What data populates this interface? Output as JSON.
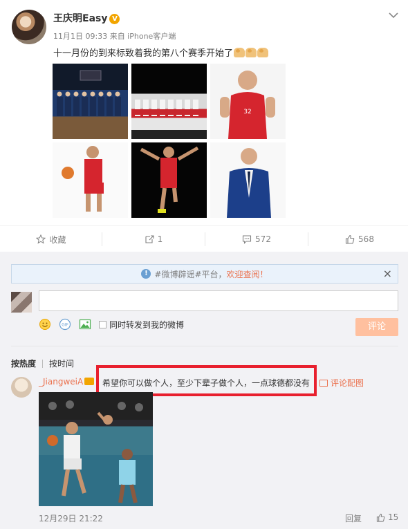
{
  "post": {
    "username": "王庆明Easy",
    "verified_badge": "V",
    "meta": "11月1日 09:33 来自 iPhone客户端",
    "text": "十一月份的到来标致着我的第八个赛季开始了",
    "photos": [
      {
        "name": "team-photo-suits"
      },
      {
        "name": "team-photo-uniforms"
      },
      {
        "name": "player-portrait-jersey"
      },
      {
        "name": "player-dribbling"
      },
      {
        "name": "player-jumping"
      },
      {
        "name": "player-portrait-suit"
      }
    ]
  },
  "actions": {
    "favorite": "收藏",
    "forward_count": "1",
    "comment_count": "572",
    "like_count": "568"
  },
  "notice": {
    "prefix": "#微博辟谣#平台，",
    "link": "欢迎查阅！",
    "close": "×"
  },
  "composer": {
    "forward_label": "同时转发到我的微博",
    "submit_label": "评论"
  },
  "sort": {
    "by_hot": "按热度",
    "by_time": "按时间"
  },
  "comment": {
    "username": "_JiangweiA",
    "text": "希望你可以做个人，至少下辈子做个人，一点球德都没有",
    "pic_link": "评论配图",
    "date": "12月29日 21:22",
    "reply_label": "回复",
    "like_count": "15"
  },
  "colors": {
    "accent": "#eb7350",
    "highlight_border": "#e8202e",
    "badge": "#f2a500"
  }
}
